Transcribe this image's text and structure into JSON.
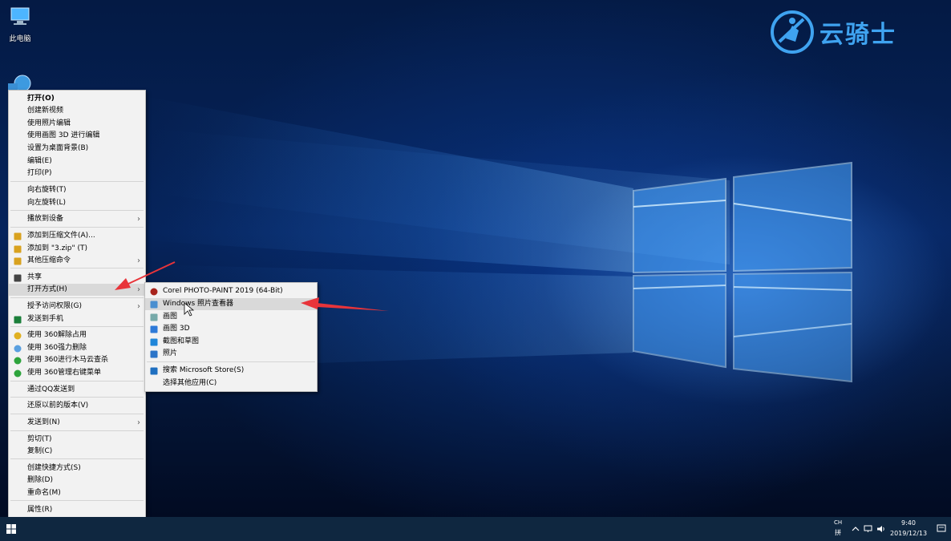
{
  "desktop": {
    "icons": [
      {
        "label": "此电脑",
        "icon": "computer-icon"
      },
      {
        "label": "",
        "icon": "network-globe-icon"
      }
    ],
    "logo": {
      "text": "云骑士",
      "icon": "knight-logo-icon",
      "color": "#3fa3f0"
    }
  },
  "context_menu": {
    "items": [
      {
        "label": "打开(O)",
        "bold": true
      },
      {
        "label": "创建新视频"
      },
      {
        "label": "使用照片编辑"
      },
      {
        "label": "使用画图 3D 进行编辑"
      },
      {
        "label": "设置为桌面背景(B)"
      },
      {
        "label": "编辑(E)"
      },
      {
        "label": "打印(P)"
      },
      {
        "label": "向右旋转(T)"
      },
      {
        "label": "向左旋转(L)"
      },
      {
        "label": "播放到设备",
        "submenu": true
      },
      {
        "label": "添加到压缩文件(A)...",
        "icon": "archive-icon"
      },
      {
        "label": "添加到 \"3.zip\" (T)",
        "icon": "archive-icon"
      },
      {
        "label": "其他压缩命令",
        "icon": "archive-icon",
        "submenu": true
      },
      {
        "label": "共享",
        "icon": "share-icon"
      },
      {
        "label": "打开方式(H)",
        "submenu": true,
        "highlighted": true
      },
      {
        "label": "授予访问权限(G)",
        "submenu": true
      },
      {
        "label": "发送到手机",
        "icon": "send-phone-icon"
      },
      {
        "label": "使用 360解除占用",
        "icon": "unlock-360-icon"
      },
      {
        "label": "使用 360强力删除",
        "icon": "delete-360-icon"
      },
      {
        "label": "使用 360进行木马云查杀",
        "icon": "scan-360-icon"
      },
      {
        "label": "使用 360管理右键菜单",
        "icon": "menu-360-icon"
      },
      {
        "label": "通过QQ发送到"
      },
      {
        "label": "还原以前的版本(V)"
      },
      {
        "label": "发送到(N)",
        "submenu": true
      },
      {
        "label": "剪切(T)"
      },
      {
        "label": "复制(C)"
      },
      {
        "label": "创建快捷方式(S)"
      },
      {
        "label": "删除(D)"
      },
      {
        "label": "重命名(M)"
      },
      {
        "label": "属性(R)"
      }
    ],
    "submenu_arrow": "›"
  },
  "open_with_menu": {
    "items": [
      {
        "label": "Corel PHOTO-PAINT 2019 (64-Bit)",
        "icon": "corel-icon"
      },
      {
        "label": "Windows 照片查看器",
        "icon": "photo-viewer-icon",
        "highlighted": true
      },
      {
        "label": "画图",
        "icon": "paint-icon"
      },
      {
        "label": "画图 3D",
        "icon": "paint3d-icon"
      },
      {
        "label": "截图和草图",
        "icon": "snip-sketch-icon"
      },
      {
        "label": "照片",
        "icon": "photos-icon"
      },
      {
        "label": "搜索 Microsoft Store(S)",
        "icon": "store-icon"
      },
      {
        "label": "选择其他应用(C)"
      }
    ]
  },
  "taskbar": {
    "start_icon": "windows-start-icon",
    "ime": "CH",
    "ime_sub": "拼",
    "tray_icons": [
      "chevron-up-icon",
      "network-icon",
      "volume-icon"
    ],
    "time": "9:40",
    "date": "2019/12/13",
    "notification_icon": "notification-icon"
  },
  "colors": {
    "accent": "#3fa3f0",
    "arrow": "#e8343a",
    "menu_bg": "#f2f2f2",
    "menu_highlight": "#d9d9d9",
    "taskbar": "#0f2740"
  }
}
